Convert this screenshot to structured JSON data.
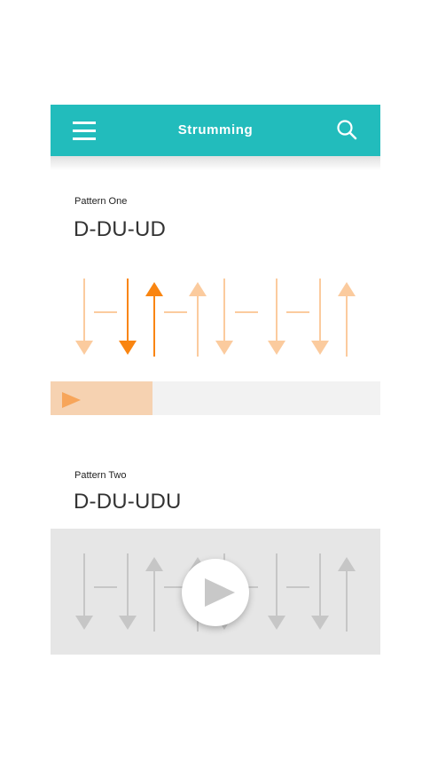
{
  "app_bar": {
    "title": "Strumming",
    "menu_icon": "hamburger-menu-icon",
    "search_icon": "search-icon",
    "color": "#22bcbc"
  },
  "patterns": [
    {
      "label": "Pattern One",
      "name": "D-DU-UD",
      "strokes": [
        "D",
        "-",
        "D",
        "U",
        "-",
        "U",
        "-",
        "D",
        "-",
        "D",
        "-",
        "D",
        "U"
      ],
      "active_strokes": [
        1,
        2
      ],
      "progress": 0.31,
      "play_icon": "play-icon"
    },
    {
      "label": "Pattern Two",
      "name": "D-DU-UDU",
      "strokes": [
        "D",
        "-",
        "D",
        "U",
        "-",
        "U",
        "-",
        "D",
        "-",
        "D",
        "-",
        "D",
        "U"
      ],
      "locked": true,
      "play_icon": "play-circle-icon"
    }
  ],
  "colors": {
    "accent": "#f98511",
    "arrow_faded": "#fbcb9e",
    "arrow_disabled": "#c6c6c6",
    "progress_fill": "#f6d2b1",
    "progress_track": "#f2f2f2",
    "locked_bg": "#e6e6e6"
  }
}
